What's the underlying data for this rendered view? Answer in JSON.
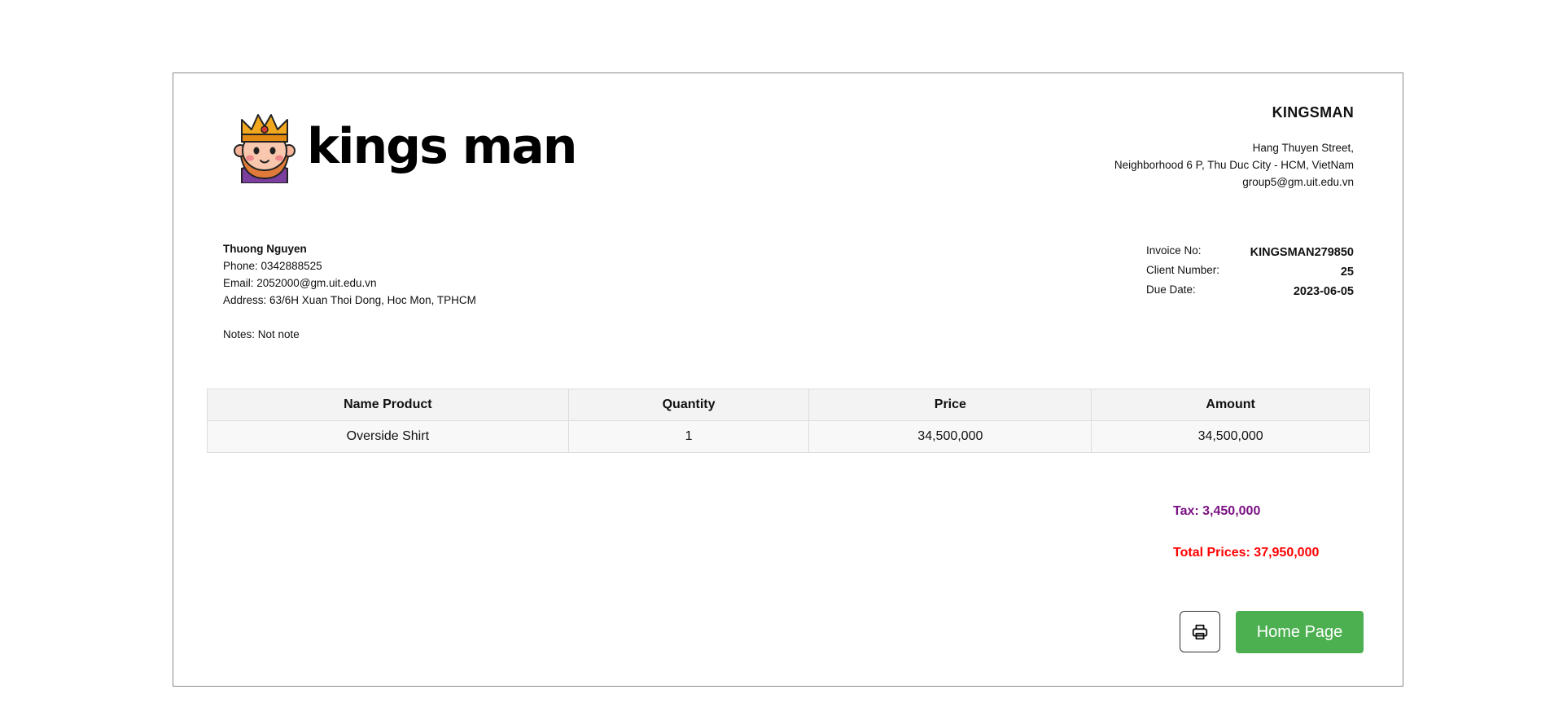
{
  "brand": {
    "logo_text": "kings man",
    "logo_icon": "king-mascot-icon"
  },
  "company": {
    "name": "KINGSMAN",
    "street": "Hang Thuyen Street,",
    "area": "Neighborhood 6 P, Thu Duc City - HCM, VietNam",
    "email": "group5@gm.uit.edu.vn"
  },
  "client": {
    "name": "Thuong Nguyen",
    "phone": "Phone: 0342888525",
    "email": "Email: 2052000@gm.uit.edu.vn",
    "address": "Address: 63/6H Xuan Thoi Dong, Hoc Mon, TPHCM",
    "notes": "Notes: Not note"
  },
  "meta": {
    "invoice_label": "Invoice No:",
    "invoice_value": "KINGSMAN279850",
    "client_label": "Client Number:",
    "client_value": "25",
    "due_label": "Due Date:",
    "due_value": "2023-06-05"
  },
  "table": {
    "headers": [
      "Name Product",
      "Quantity",
      "Price",
      "Amount"
    ],
    "rows": [
      [
        "Overside Shirt",
        "1",
        "34,500,000",
        "34,500,000"
      ]
    ]
  },
  "summary": {
    "tax": "Tax: 3,450,000",
    "total": "Total Prices: 37,950,000"
  },
  "actions": {
    "print_icon": "printer-icon",
    "home_label": "Home Page"
  },
  "colors": {
    "tax": "#7b1185",
    "total": "#ff0000",
    "home_button": "#4caf50"
  }
}
